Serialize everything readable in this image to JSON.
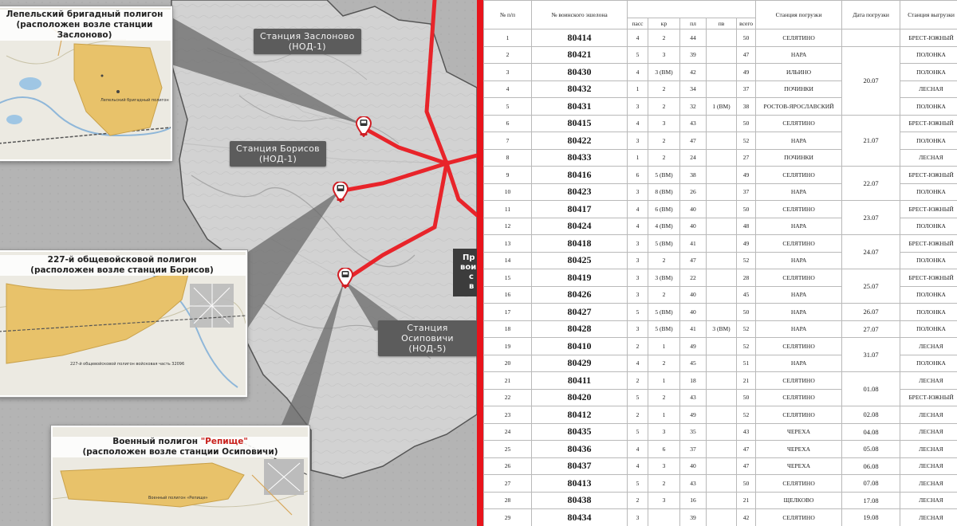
{
  "map": {
    "stations": [
      {
        "name": "Станция Заслоново",
        "code": "(НОД-1)"
      },
      {
        "name": "Станция Борисов",
        "code": "(НОД-1)"
      },
      {
        "name": "Станция Осиповичи",
        "code": "(НОД-5)"
      }
    ],
    "insets": [
      {
        "title_line1": "Лепельский бригадный полигон",
        "title_line2": "(расположен возле станции Заслоново)",
        "map_label": "Лепельский бригадный полигон"
      },
      {
        "title_line1": "227-й общевойсковой полигон",
        "title_line2": "(расположен возле станции Борисов)",
        "map_label": "227-й общевойсковой полигон войсковая часть 32096"
      },
      {
        "title_prefix": "Военный полигон ",
        "title_accent": "\"Репище\"",
        "title_line2": "(расположен возле станции Осиповичи)",
        "map_label": "Военный полигон «Репище»"
      }
    ],
    "right_edge_text": [
      "Пр",
      "вои",
      "с",
      "в"
    ],
    "colors": {
      "route": "#e8242a",
      "divider": "#e8141c",
      "label_bg": "#5c5c5c",
      "polygon": "#e8c26a"
    }
  },
  "table": {
    "headers": {
      "num": "№ п/п",
      "echelon": "№ воинского эшелона",
      "pass": "пасс",
      "kr": "кр",
      "pl": "пл",
      "pv": "пв",
      "total": "всего",
      "load_station": "Станция погрузки",
      "load_date": "Дата погрузки",
      "unload_station": "Станция выгрузки"
    },
    "rows": [
      {
        "n": "1",
        "ech": "80414",
        "pass": "4",
        "kr": "2",
        "pl": "44",
        "pv": "",
        "total": "50",
        "load": "СЕЛЯТИНО",
        "unload": "БРЕСТ-ЮЖНЫЙ"
      },
      {
        "n": "2",
        "ech": "80421",
        "pass": "5",
        "kr": "3",
        "pl": "39",
        "pv": "",
        "total": "47",
        "load": "НАРА",
        "unload": "ПОЛОНКА"
      },
      {
        "n": "3",
        "ech": "80430",
        "pass": "4",
        "kr": "3 (ВМ)",
        "pl": "42",
        "pv": "",
        "total": "49",
        "load": "ИЛЬИНО",
        "unload": "ПОЛОНКА"
      },
      {
        "n": "4",
        "ech": "80432",
        "pass": "1",
        "kr": "2",
        "pl": "34",
        "pv": "",
        "total": "37",
        "load": "ПОЧИНКИ",
        "unload": "ЛЕСНАЯ"
      },
      {
        "n": "5",
        "ech": "80431",
        "pass": "3",
        "kr": "2",
        "pl": "32",
        "pv": "1 (ВМ)",
        "total": "38",
        "load": "РОСТОВ-ЯРОСЛАВСКИЙ",
        "unload": "ПОЛОНКА"
      },
      {
        "n": "6",
        "ech": "80415",
        "pass": "4",
        "kr": "3",
        "pl": "43",
        "pv": "",
        "total": "50",
        "load": "СЕЛЯТИНО",
        "unload": "БРЕСТ-ЮЖНЫЙ"
      },
      {
        "n": "7",
        "ech": "80422",
        "pass": "3",
        "kr": "2",
        "pl": "47",
        "pv": "",
        "total": "52",
        "load": "НАРА",
        "unload": "ПОЛОНКА"
      },
      {
        "n": "8",
        "ech": "80433",
        "pass": "1",
        "kr": "2",
        "pl": "24",
        "pv": "",
        "total": "27",
        "load": "ПОЧИНКИ",
        "unload": "ЛЕСНАЯ"
      },
      {
        "n": "9",
        "ech": "80416",
        "pass": "6",
        "kr": "5 (ВМ)",
        "pl": "38",
        "pv": "",
        "total": "49",
        "load": "СЕЛЯТИНО",
        "unload": "БРЕСТ-ЮЖНЫЙ"
      },
      {
        "n": "10",
        "ech": "80423",
        "pass": "3",
        "kr": "8 (ВМ)",
        "pl": "26",
        "pv": "",
        "total": "37",
        "load": "НАРА",
        "unload": "ПОЛОНКА"
      },
      {
        "n": "11",
        "ech": "80417",
        "pass": "4",
        "kr": "6 (ВМ)",
        "pl": "40",
        "pv": "",
        "total": "50",
        "load": "СЕЛЯТИНО",
        "unload": "БРЕСТ-ЮЖНЫЙ"
      },
      {
        "n": "12",
        "ech": "80424",
        "pass": "4",
        "kr": "4 (ВМ)",
        "pl": "40",
        "pv": "",
        "total": "48",
        "load": "НАРА",
        "unload": "ПОЛОНКА"
      },
      {
        "n": "13",
        "ech": "80418",
        "pass": "3",
        "kr": "5 (ВМ)",
        "pl": "41",
        "pv": "",
        "total": "49",
        "load": "СЕЛЯТИНО",
        "unload": "БРЕСТ-ЮЖНЫЙ"
      },
      {
        "n": "14",
        "ech": "80425",
        "pass": "3",
        "kr": "2",
        "pl": "47",
        "pv": "",
        "total": "52",
        "load": "НАРА",
        "unload": "ПОЛОНКА"
      },
      {
        "n": "15",
        "ech": "80419",
        "pass": "3",
        "kr": "3 (ВМ)",
        "pl": "22",
        "pv": "",
        "total": "28",
        "load": "СЕЛЯТИНО",
        "unload": "БРЕСТ-ЮЖНЫЙ"
      },
      {
        "n": "16",
        "ech": "80426",
        "pass": "3",
        "kr": "2",
        "pl": "40",
        "pv": "",
        "total": "45",
        "load": "НАРА",
        "unload": "ПОЛОНКА"
      },
      {
        "n": "17",
        "ech": "80427",
        "pass": "5",
        "kr": "5 (ВМ)",
        "pl": "40",
        "pv": "",
        "total": "50",
        "load": "НАРА",
        "unload": "ПОЛОНКА"
      },
      {
        "n": "18",
        "ech": "80428",
        "pass": "3",
        "kr": "5 (ВМ)",
        "pl": "41",
        "pv": "3 (ВМ)",
        "total": "52",
        "load": "НАРА",
        "unload": "ПОЛОНКА"
      },
      {
        "n": "19",
        "ech": "80410",
        "pass": "2",
        "kr": "1",
        "pl": "49",
        "pv": "",
        "total": "52",
        "load": "СЕЛЯТИНО",
        "unload": "ЛЕСНАЯ"
      },
      {
        "n": "20",
        "ech": "80429",
        "pass": "4",
        "kr": "2",
        "pl": "45",
        "pv": "",
        "total": "51",
        "load": "НАРА",
        "unload": "ПОЛОНКА"
      },
      {
        "n": "21",
        "ech": "80411",
        "pass": "2",
        "kr": "1",
        "pl": "18",
        "pv": "",
        "total": "21",
        "load": "СЕЛЯТИНО",
        "unload": "ЛЕСНАЯ"
      },
      {
        "n": "22",
        "ech": "80420",
        "pass": "5",
        "kr": "2",
        "pl": "43",
        "pv": "",
        "total": "50",
        "load": "СЕЛЯТИНО",
        "unload": "БРЕСТ-ЮЖНЫЙ"
      },
      {
        "n": "23",
        "ech": "80412",
        "pass": "2",
        "kr": "1",
        "pl": "49",
        "pv": "",
        "total": "52",
        "load": "СЕЛЯТИНО",
        "unload": "ЛЕСНАЯ"
      },
      {
        "n": "24",
        "ech": "80435",
        "pass": "5",
        "kr": "3",
        "pl": "35",
        "pv": "",
        "total": "43",
        "load": "ЧЕРЕХА",
        "unload": "ЛЕСНАЯ"
      },
      {
        "n": "25",
        "ech": "80436",
        "pass": "4",
        "kr": "6",
        "pl": "37",
        "pv": "",
        "total": "47",
        "load": "ЧЕРЕХА",
        "unload": "ЛЕСНАЯ"
      },
      {
        "n": "26",
        "ech": "80437",
        "pass": "4",
        "kr": "3",
        "pl": "40",
        "pv": "",
        "total": "47",
        "load": "ЧЕРЕХА",
        "unload": "ЛЕСНАЯ"
      },
      {
        "n": "27",
        "ech": "80413",
        "pass": "5",
        "kr": "2",
        "pl": "43",
        "pv": "",
        "total": "50",
        "load": "СЕЛЯТИНО",
        "unload": "ЛЕСНАЯ"
      },
      {
        "n": "28",
        "ech": "80438",
        "pass": "2",
        "kr": "3",
        "pl": "16",
        "pv": "",
        "total": "21",
        "load": "ЩЕЛКОВО",
        "unload": "ЛЕСНАЯ"
      },
      {
        "n": "29",
        "ech": "80434",
        "pass": "3",
        "kr": "",
        "pl": "39",
        "pv": "",
        "total": "42",
        "load": "СЕЛЯТИНО",
        "unload": "ЛЕСНАЯ"
      }
    ],
    "dates": [
      {
        "start": 1,
        "span": 1,
        "date": ""
      },
      {
        "start": 2,
        "span": 4,
        "date": "20.07"
      },
      {
        "start": 6,
        "span": 3,
        "date": "21.07"
      },
      {
        "start": 9,
        "span": 2,
        "date": "22.07"
      },
      {
        "start": 11,
        "span": 2,
        "date": "23.07"
      },
      {
        "start": 13,
        "span": 2,
        "date": "24.07"
      },
      {
        "start": 15,
        "span": 2,
        "date": "25.07"
      },
      {
        "start": 17,
        "span": 1,
        "date": "26.07"
      },
      {
        "start": 18,
        "span": 1,
        "date": "27.07"
      },
      {
        "start": 19,
        "span": 2,
        "date": "31.07"
      },
      {
        "start": 21,
        "span": 2,
        "date": "01.08"
      },
      {
        "start": 23,
        "span": 1,
        "date": "02.08"
      },
      {
        "start": 24,
        "span": 1,
        "date": "04.08"
      },
      {
        "start": 25,
        "span": 1,
        "date": "05.08"
      },
      {
        "start": 26,
        "span": 1,
        "date": "06.08"
      },
      {
        "start": 27,
        "span": 1,
        "date": "07.08"
      },
      {
        "start": 28,
        "span": 1,
        "date": "17.08"
      },
      {
        "start": 29,
        "span": 1,
        "date": "19.08"
      }
    ]
  }
}
